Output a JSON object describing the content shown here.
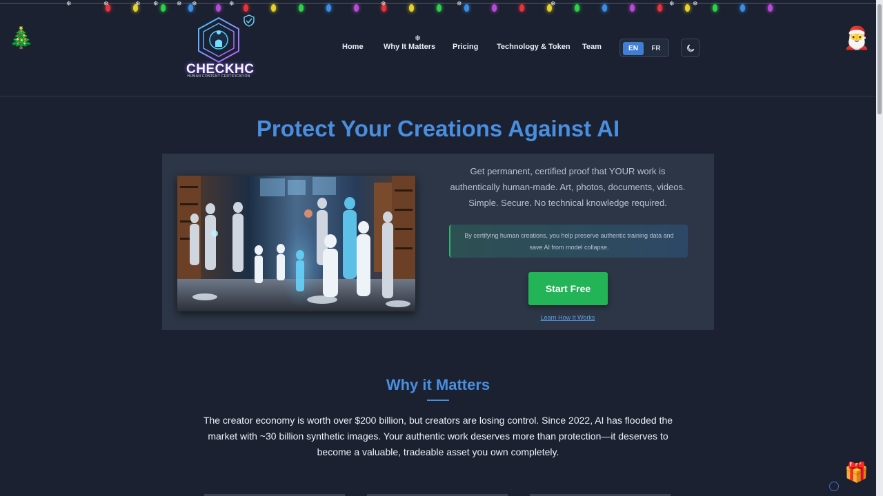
{
  "brand": {
    "name": "CHECKHC",
    "tagline": "HUMAN CONTENT CERTIFICATION"
  },
  "nav": {
    "items": [
      "Home",
      "Why It Matters",
      "Pricing",
      "Technology & Token",
      "Team"
    ],
    "lang_en": "EN",
    "lang_fr": "FR",
    "active_lang": "EN",
    "theme_icon": "moon-icon"
  },
  "hero": {
    "title": "Protect Your Creations Against AI",
    "description": "Get permanent, certified proof that YOUR work is authentically human-made. Art, photos, documents, videos. Simple. Secure. No technical knowledge required.",
    "note": "By certifying human creations, you help preserve authentic training data and save AI from model collapse.",
    "cta_label": "Start Free",
    "link_label": "Learn How It Works"
  },
  "why": {
    "title": "Why it Matters",
    "text": "The creator economy is worth over $200 billion, but creators are losing control. Since 2022, AI has flooded the market with ~30 billion synthetic images. Your authentic work deserves more than protection—it deserves to become a valuable, tradeable asset you own completely."
  },
  "decor": {
    "tree_icon": "🎄",
    "santa_icon": "🎅",
    "gift_icon": "🎁",
    "snowflake": "❄"
  },
  "colors": {
    "background": "#1b2130",
    "accent_blue": "#4a8ee0",
    "cta_green": "#23b458",
    "card": "#2d3646"
  }
}
